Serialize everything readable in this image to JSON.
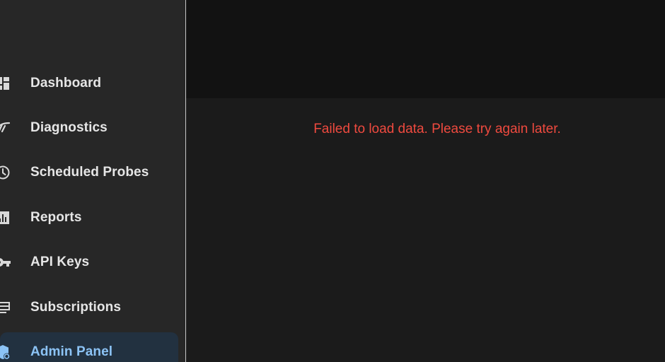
{
  "sidebar": {
    "items": [
      {
        "label": "Dashboard",
        "icon": "dashboard-icon"
      },
      {
        "label": "Diagnostics",
        "icon": "diagnostics-icon"
      },
      {
        "label": "Scheduled Probes",
        "icon": "clock-icon"
      },
      {
        "label": "Reports",
        "icon": "bar-chart-icon"
      },
      {
        "label": "API Keys",
        "icon": "key-icon"
      },
      {
        "label": "Subscriptions",
        "icon": "subscriptions-icon"
      },
      {
        "label": "Admin Panel",
        "icon": "admin-shield-icon",
        "active": true
      }
    ]
  },
  "main": {
    "error_message": "Failed to load data. Please try again later."
  },
  "colors": {
    "sidebar_bg": "#272727",
    "topbar_bg": "#121212",
    "content_bg": "#1b1b1b",
    "active_bg": "#223140",
    "active_text": "#8cc3f5",
    "error": "#ef4a3f"
  }
}
